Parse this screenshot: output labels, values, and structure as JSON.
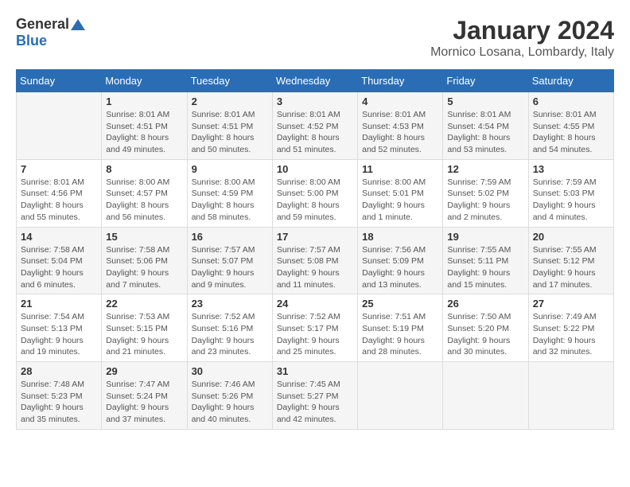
{
  "header": {
    "logo_general": "General",
    "logo_blue": "Blue",
    "title": "January 2024",
    "subtitle": "Mornico Losana, Lombardy, Italy"
  },
  "weekdays": [
    "Sunday",
    "Monday",
    "Tuesday",
    "Wednesday",
    "Thursday",
    "Friday",
    "Saturday"
  ],
  "weeks": [
    [
      {
        "day": "",
        "info": ""
      },
      {
        "day": "1",
        "info": "Sunrise: 8:01 AM\nSunset: 4:51 PM\nDaylight: 8 hours\nand 49 minutes."
      },
      {
        "day": "2",
        "info": "Sunrise: 8:01 AM\nSunset: 4:51 PM\nDaylight: 8 hours\nand 50 minutes."
      },
      {
        "day": "3",
        "info": "Sunrise: 8:01 AM\nSunset: 4:52 PM\nDaylight: 8 hours\nand 51 minutes."
      },
      {
        "day": "4",
        "info": "Sunrise: 8:01 AM\nSunset: 4:53 PM\nDaylight: 8 hours\nand 52 minutes."
      },
      {
        "day": "5",
        "info": "Sunrise: 8:01 AM\nSunset: 4:54 PM\nDaylight: 8 hours\nand 53 minutes."
      },
      {
        "day": "6",
        "info": "Sunrise: 8:01 AM\nSunset: 4:55 PM\nDaylight: 8 hours\nand 54 minutes."
      }
    ],
    [
      {
        "day": "7",
        "info": "Sunrise: 8:01 AM\nSunset: 4:56 PM\nDaylight: 8 hours\nand 55 minutes."
      },
      {
        "day": "8",
        "info": "Sunrise: 8:00 AM\nSunset: 4:57 PM\nDaylight: 8 hours\nand 56 minutes."
      },
      {
        "day": "9",
        "info": "Sunrise: 8:00 AM\nSunset: 4:59 PM\nDaylight: 8 hours\nand 58 minutes."
      },
      {
        "day": "10",
        "info": "Sunrise: 8:00 AM\nSunset: 5:00 PM\nDaylight: 8 hours\nand 59 minutes."
      },
      {
        "day": "11",
        "info": "Sunrise: 8:00 AM\nSunset: 5:01 PM\nDaylight: 9 hours\nand 1 minute."
      },
      {
        "day": "12",
        "info": "Sunrise: 7:59 AM\nSunset: 5:02 PM\nDaylight: 9 hours\nand 2 minutes."
      },
      {
        "day": "13",
        "info": "Sunrise: 7:59 AM\nSunset: 5:03 PM\nDaylight: 9 hours\nand 4 minutes."
      }
    ],
    [
      {
        "day": "14",
        "info": "Sunrise: 7:58 AM\nSunset: 5:04 PM\nDaylight: 9 hours\nand 6 minutes."
      },
      {
        "day": "15",
        "info": "Sunrise: 7:58 AM\nSunset: 5:06 PM\nDaylight: 9 hours\nand 7 minutes."
      },
      {
        "day": "16",
        "info": "Sunrise: 7:57 AM\nSunset: 5:07 PM\nDaylight: 9 hours\nand 9 minutes."
      },
      {
        "day": "17",
        "info": "Sunrise: 7:57 AM\nSunset: 5:08 PM\nDaylight: 9 hours\nand 11 minutes."
      },
      {
        "day": "18",
        "info": "Sunrise: 7:56 AM\nSunset: 5:09 PM\nDaylight: 9 hours\nand 13 minutes."
      },
      {
        "day": "19",
        "info": "Sunrise: 7:55 AM\nSunset: 5:11 PM\nDaylight: 9 hours\nand 15 minutes."
      },
      {
        "day": "20",
        "info": "Sunrise: 7:55 AM\nSunset: 5:12 PM\nDaylight: 9 hours\nand 17 minutes."
      }
    ],
    [
      {
        "day": "21",
        "info": "Sunrise: 7:54 AM\nSunset: 5:13 PM\nDaylight: 9 hours\nand 19 minutes."
      },
      {
        "day": "22",
        "info": "Sunrise: 7:53 AM\nSunset: 5:15 PM\nDaylight: 9 hours\nand 21 minutes."
      },
      {
        "day": "23",
        "info": "Sunrise: 7:52 AM\nSunset: 5:16 PM\nDaylight: 9 hours\nand 23 minutes."
      },
      {
        "day": "24",
        "info": "Sunrise: 7:52 AM\nSunset: 5:17 PM\nDaylight: 9 hours\nand 25 minutes."
      },
      {
        "day": "25",
        "info": "Sunrise: 7:51 AM\nSunset: 5:19 PM\nDaylight: 9 hours\nand 28 minutes."
      },
      {
        "day": "26",
        "info": "Sunrise: 7:50 AM\nSunset: 5:20 PM\nDaylight: 9 hours\nand 30 minutes."
      },
      {
        "day": "27",
        "info": "Sunrise: 7:49 AM\nSunset: 5:22 PM\nDaylight: 9 hours\nand 32 minutes."
      }
    ],
    [
      {
        "day": "28",
        "info": "Sunrise: 7:48 AM\nSunset: 5:23 PM\nDaylight: 9 hours\nand 35 minutes."
      },
      {
        "day": "29",
        "info": "Sunrise: 7:47 AM\nSunset: 5:24 PM\nDaylight: 9 hours\nand 37 minutes."
      },
      {
        "day": "30",
        "info": "Sunrise: 7:46 AM\nSunset: 5:26 PM\nDaylight: 9 hours\nand 40 minutes."
      },
      {
        "day": "31",
        "info": "Sunrise: 7:45 AM\nSunset: 5:27 PM\nDaylight: 9 hours\nand 42 minutes."
      },
      {
        "day": "",
        "info": ""
      },
      {
        "day": "",
        "info": ""
      },
      {
        "day": "",
        "info": ""
      }
    ]
  ]
}
